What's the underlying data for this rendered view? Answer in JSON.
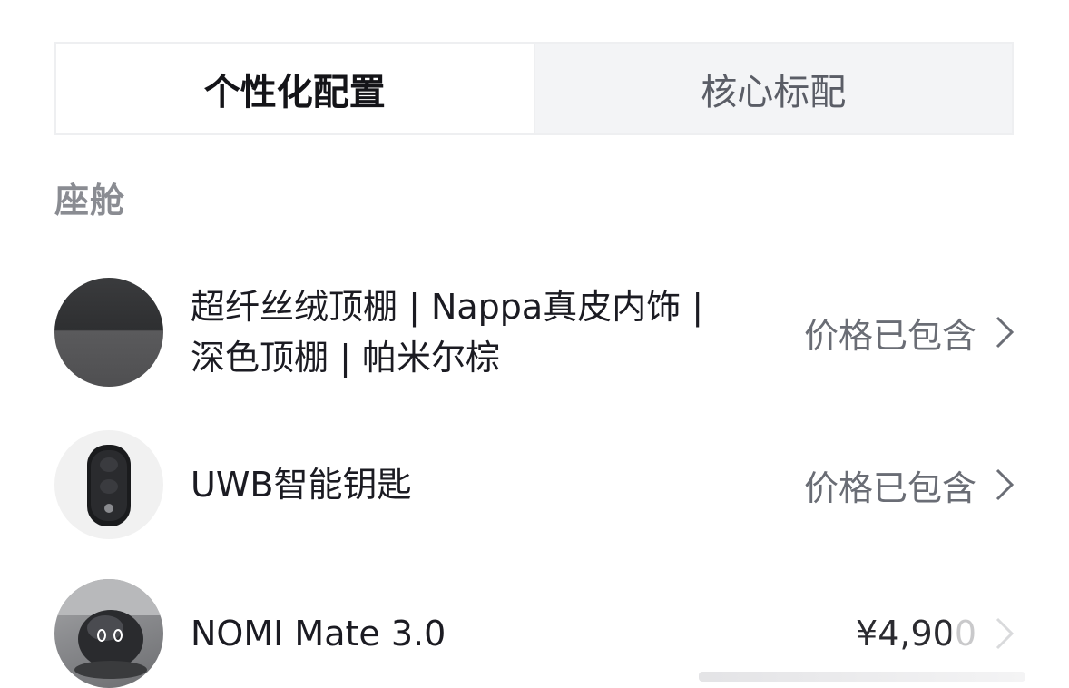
{
  "tabs": {
    "personal": "个性化配置",
    "core": "核心标配"
  },
  "section": {
    "title": "座舱"
  },
  "items": [
    {
      "line1": "超纤丝绒顶棚 | Nappa真皮内饰 |",
      "line2": "深色顶棚 | 帕米尔棕",
      "status": "价格已包含",
      "thumb_icon": "fabric-swatch-icon"
    },
    {
      "line1": "UWB智能钥匙",
      "status": "价格已包含",
      "thumb_icon": "smart-key-icon"
    },
    {
      "line1": "NOMI Mate 3.0",
      "price": "¥4,900",
      "thumb_icon": "nomi-robot-icon"
    }
  ],
  "colors": {
    "tab_active_bg": "#ffffff",
    "tab_inactive_bg": "#f3f4f6",
    "section_title": "#8a8c92",
    "status_text": "#6a6d75"
  }
}
